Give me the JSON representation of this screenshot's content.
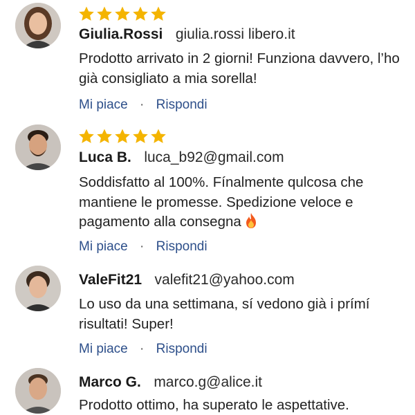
{
  "comments": [
    {
      "name": "Giulia.Rossi",
      "email": "giulia.rossi libero.it",
      "rating": 5,
      "text": "Prodotto arrivato in 2 giorni! Funziona davvero, l’ho già consigliato a mia sorella!",
      "like_label": "Mi piace",
      "reply_label": "Rispondi"
    },
    {
      "name": "Luca B.",
      "email": "luca_b92@gmail.com",
      "rating": 5,
      "text": "Soddisfatto al 100%. Fínalmente qulcosa che mantiene le promesse. Spedizione veloce e pagamento alla consegna",
      "emoji": "fire-emoji",
      "like_label": "Mi piace",
      "reply_label": "Rispondi"
    },
    {
      "name": "ValeFit21",
      "email": "valefit21@yahoo.com",
      "text": "Lo uso da una settimana, sí vedono già i prímí risultati! Super!",
      "like_label": "Mi piace",
      "reply_label": "Rispondi"
    },
    {
      "name": "Marco G.",
      "email": "marco.g@alice.it",
      "text": "Prodotto ottimo, ha superato le aspettative."
    }
  ],
  "separator": "·",
  "colors": {
    "star": "#f4b400",
    "link": "#2d4f8a"
  }
}
